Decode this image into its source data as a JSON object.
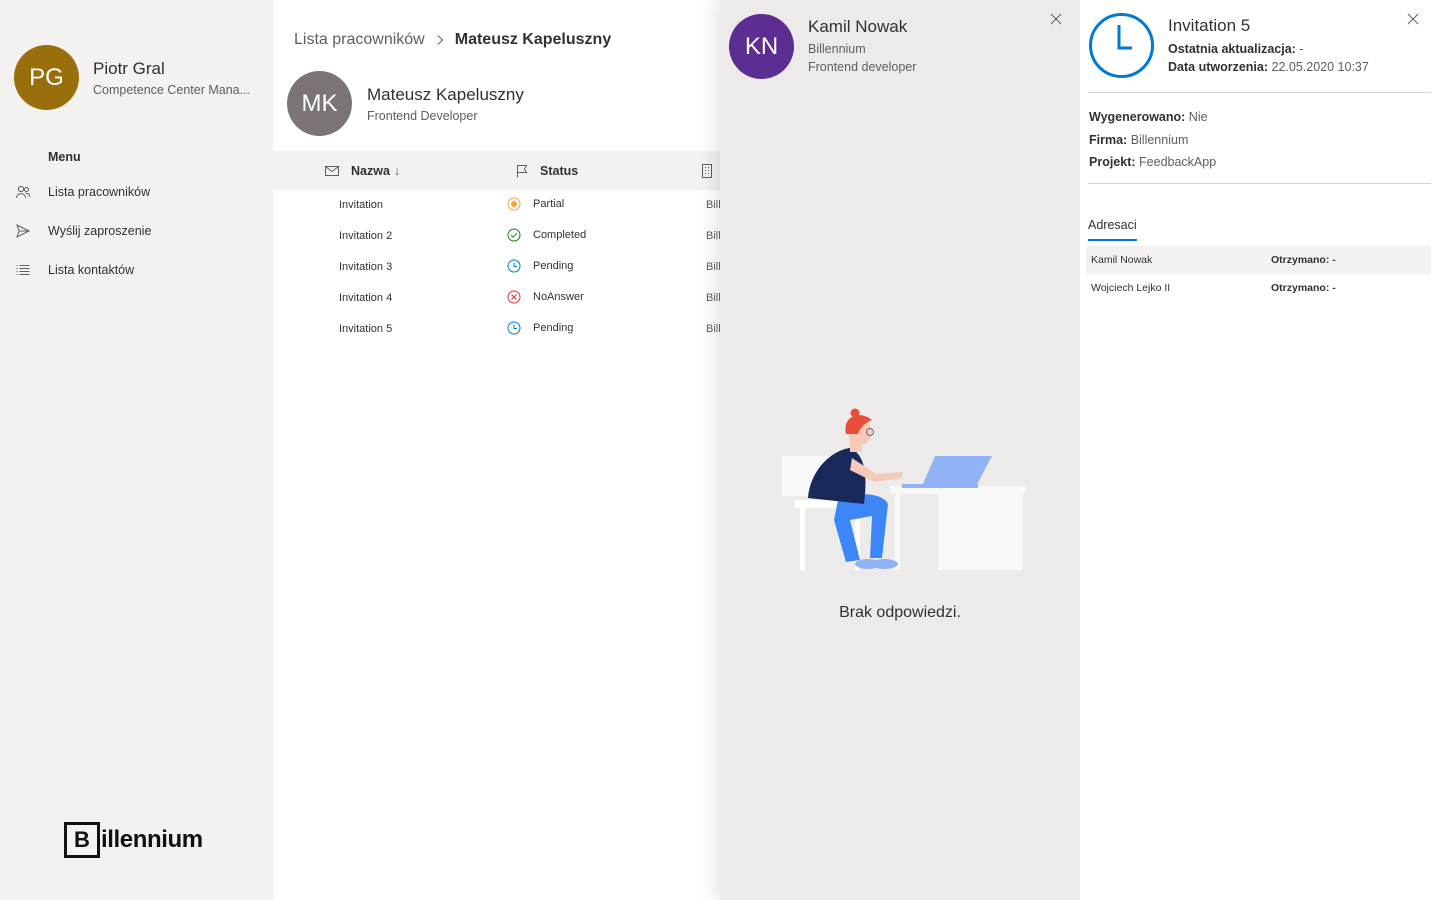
{
  "sidebar": {
    "user": {
      "initials": "PG",
      "name": "Piotr Gral",
      "role": "Competence Center Mana...",
      "avatar_color": "#986f0b"
    },
    "menu_heading": "Menu",
    "items": [
      {
        "label": "Lista pracowników",
        "icon": "people-icon"
      },
      {
        "label": "Wyślij zaproszenie",
        "icon": "send-icon"
      },
      {
        "label": "Lista kontaktów",
        "icon": "list-icon"
      }
    ],
    "brand": {
      "letter": "B",
      "text": "illennium"
    }
  },
  "main": {
    "breadcrumb": {
      "root": "Lista pracowników",
      "current": "Mateusz Kapeluszny"
    },
    "profile": {
      "initials": "MK",
      "name": "Mateusz Kapeluszny",
      "role": "Frontend Developer",
      "avatar_color": "#7a7574"
    },
    "table": {
      "headers": {
        "name": "Nazwa",
        "sort_indicator": "↓",
        "status": "Status"
      },
      "rows": [
        {
          "name": "Invitation",
          "status": "Partial",
          "company": "Bill"
        },
        {
          "name": "Invitation 2",
          "status": "Completed",
          "company": "Bill"
        },
        {
          "name": "Invitation 3",
          "status": "Pending",
          "company": "Bill"
        },
        {
          "name": "Invitation 4",
          "status": "NoAnswer",
          "company": "Bill"
        },
        {
          "name": "Invitation 5",
          "status": "Pending",
          "company": "Bill"
        }
      ]
    }
  },
  "contact_panel": {
    "initials": "KN",
    "name": "Kamil Nowak",
    "company": "Billennium",
    "role": "Frontend developer",
    "avatar_color": "#5c2e91",
    "empty_message": "Brak odpowiedzi."
  },
  "invitation_panel": {
    "title": "Invitation 5",
    "last_update_label": "Ostatnia aktualizacja:",
    "last_update_value": "-",
    "created_label": "Data utworzenia:",
    "created_value": "22.05.2020 10:37",
    "generated_label": "Wygenerowano:",
    "generated_value": "Nie",
    "company_label": "Firma:",
    "company_value": "Billennium",
    "project_label": "Projekt:",
    "project_value": "FeedbackApp",
    "tab_label": "Adresaci",
    "recipients": [
      {
        "name": "Kamil Nowak",
        "received_label": "Otrzymano:",
        "received_value": "-"
      },
      {
        "name": "Wojciech Lejko II",
        "received_label": "Otrzymano:",
        "received_value": "-"
      }
    ]
  },
  "colors": {
    "accent": "#0078d4",
    "status_partial": "#f7a234",
    "status_completed": "#107c10",
    "status_pending": "#0078d4",
    "status_noanswer": "#d13438"
  }
}
